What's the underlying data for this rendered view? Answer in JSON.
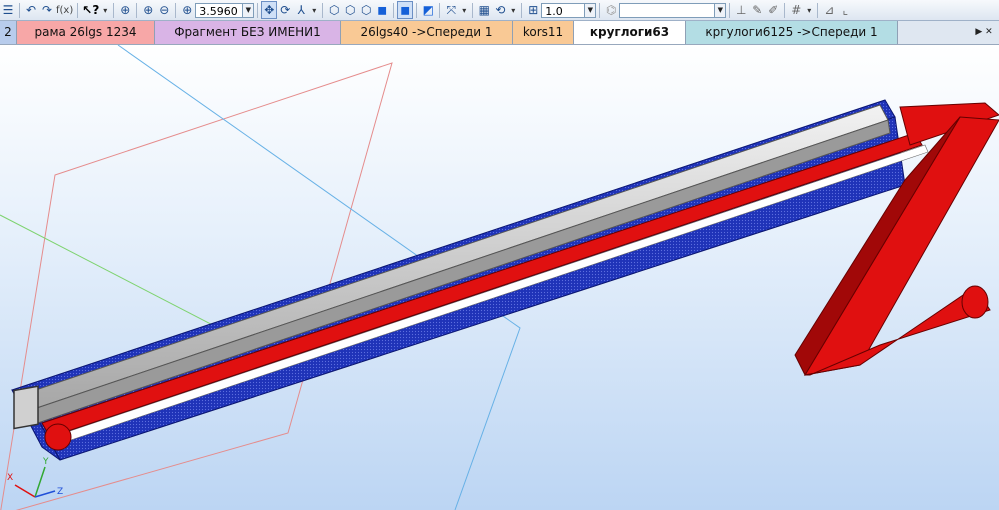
{
  "toolbar": {
    "zoom_value": "3.5960",
    "step_value": "1.0",
    "fx_label": "f(x)",
    "help_label": "?"
  },
  "tabs": [
    {
      "label": "2",
      "color": "#b8ccec"
    },
    {
      "label": "рама 26lgs 1234",
      "color": "#f7a7a7"
    },
    {
      "label": "Фрагмент БЕЗ ИМЕНИ1",
      "color": "#d9b4e6"
    },
    {
      "label": "26lgs40 ->Спереди 1",
      "color": "#f9c995"
    },
    {
      "label": "kors11",
      "color": "#f9c995"
    },
    {
      "label": "круглоги63",
      "color": "#ffffff"
    },
    {
      "label": "кргулоги6125 ->Спереди 1",
      "color": "#b3dde4"
    }
  ],
  "axes": {
    "x": "X",
    "y": "Y",
    "z": "Z"
  },
  "colors": {
    "blue_rail": "#1f33b8",
    "red_part": "#e01010",
    "grey_profile": "#c8c8c8"
  }
}
